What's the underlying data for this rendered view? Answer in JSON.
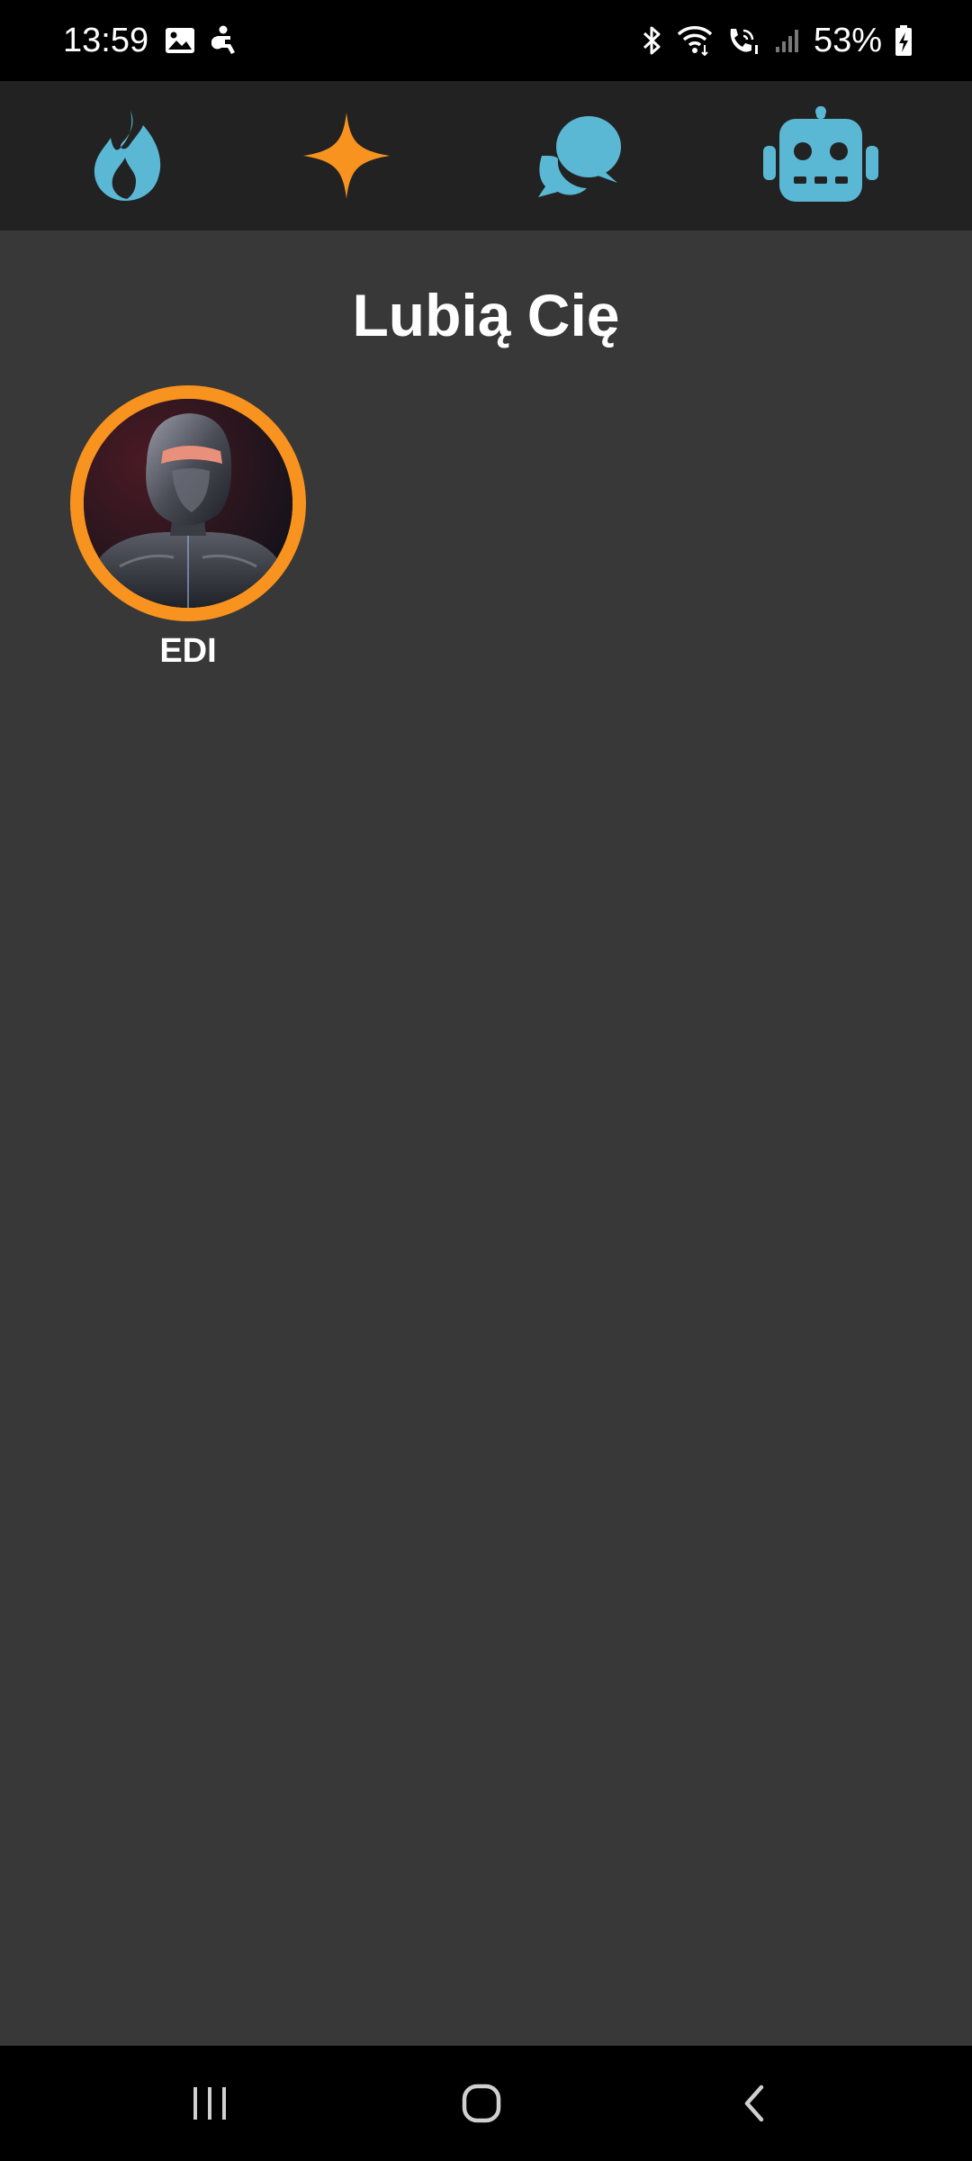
{
  "status_bar": {
    "time": "13:59",
    "battery": "53%",
    "icons": [
      "gallery-icon",
      "accessibility-icon",
      "bluetooth-icon",
      "wifi-icon",
      "wifi-call-icon",
      "signal-icon",
      "battery-charging-icon"
    ]
  },
  "top_nav": {
    "items": [
      {
        "icon": "flame-icon",
        "color": "#5ab8d4",
        "active": false
      },
      {
        "icon": "sparkle-icon",
        "color": "#f7931e",
        "active": true
      },
      {
        "icon": "chat-icon",
        "color": "#5ab8d4",
        "active": false
      },
      {
        "icon": "robot-icon",
        "color": "#5ab8d4",
        "active": false
      }
    ]
  },
  "main": {
    "title": "Lubią Cię",
    "profiles": [
      {
        "name": "EDI",
        "ring_color": "#f7931e"
      }
    ]
  },
  "system_nav": {
    "buttons": [
      "recents-icon",
      "home-icon",
      "back-icon"
    ]
  }
}
